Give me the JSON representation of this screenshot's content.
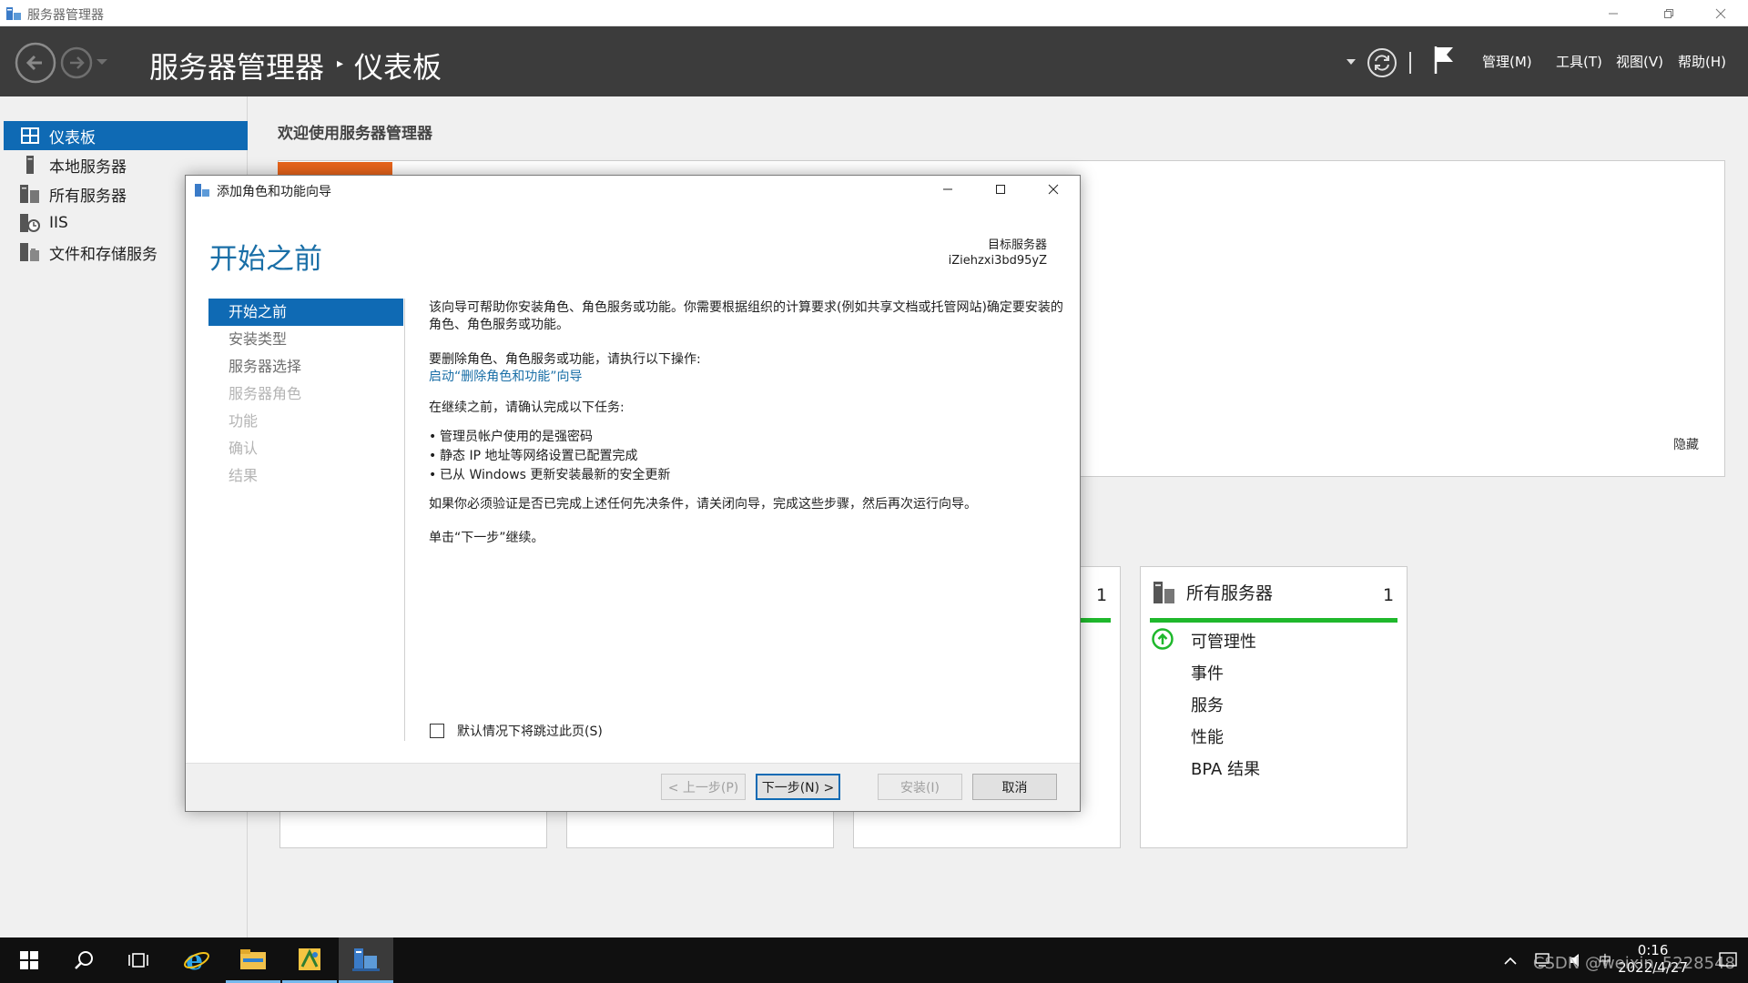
{
  "window": {
    "title": "服务器管理器"
  },
  "toolbar": {
    "breadcrumb_root": "服务器管理器",
    "breadcrumb_sep": "▸",
    "breadcrumb_page": "仪表板",
    "menus": [
      "管理(M)",
      "工具(T)",
      "视图(V)",
      "帮助(H)"
    ]
  },
  "nav": {
    "items": [
      {
        "label": "仪表板",
        "icon": "dashboard-icon"
      },
      {
        "label": "本地服务器",
        "icon": "local-server-icon"
      },
      {
        "label": "所有服务器",
        "icon": "all-servers-icon"
      },
      {
        "label": "IIS",
        "icon": "iis-icon"
      },
      {
        "label": "文件和存储服务",
        "icon": "file-storage-icon"
      }
    ]
  },
  "content": {
    "welcome": "欢迎使用服务器管理器",
    "hide": "隐藏",
    "tile_partial_count": "1",
    "tile_all": {
      "title": "所有服务器",
      "count": "1",
      "rows": [
        "可管理性",
        "事件",
        "服务",
        "性能",
        "BPA 结果"
      ]
    }
  },
  "dialog": {
    "title": "添加角色和功能向导",
    "heading": "开始之前",
    "target_label": "目标服务器",
    "target_name": "iZiehzxi3bd95yZ",
    "steps": [
      {
        "label": "开始之前",
        "state": "current"
      },
      {
        "label": "安装类型",
        "state": "enabled"
      },
      {
        "label": "服务器选择",
        "state": "enabled"
      },
      {
        "label": "服务器角色",
        "state": "disabled"
      },
      {
        "label": "功能",
        "state": "disabled"
      },
      {
        "label": "确认",
        "state": "disabled"
      },
      {
        "label": "结果",
        "state": "disabled"
      }
    ],
    "p1": "该向导可帮助你安装角色、角色服务或功能。你需要根据组织的计算要求(例如共享文档或托管网站)确定要安装的角色、角色服务或功能。",
    "p2": "要删除角色、角色服务或功能，请执行以下操作:",
    "link": "启动“删除角色和功能”向导",
    "p3": "在继续之前，请确认完成以下任务:",
    "bullets": [
      "管理员帐户使用的是强密码",
      "静态 IP 地址等网络设置已配置完成",
      "已从 Windows 更新安装最新的安全更新"
    ],
    "p4": "如果你必须验证是否已完成上述任何先决条件，请关闭向导，完成这些步骤，然后再次运行向导。",
    "p5": "单击“下一步”继续。",
    "skip_label": "默认情况下将跳过此页(S)",
    "buttons": {
      "prev": "< 上一步(P)",
      "next": "下一步(N) >",
      "install": "安装(I)",
      "cancel": "取消"
    }
  },
  "taskbar": {
    "time": "0:16",
    "date": "2022/4/27",
    "ime": "中",
    "watermark": "CSDN @weixin_5228548"
  },
  "colors": {
    "accent": "#0f6ab4",
    "toolbar": "#3c3c3c",
    "tile_green": "#1fb82c",
    "quickstart_orange": "#e8641b"
  }
}
